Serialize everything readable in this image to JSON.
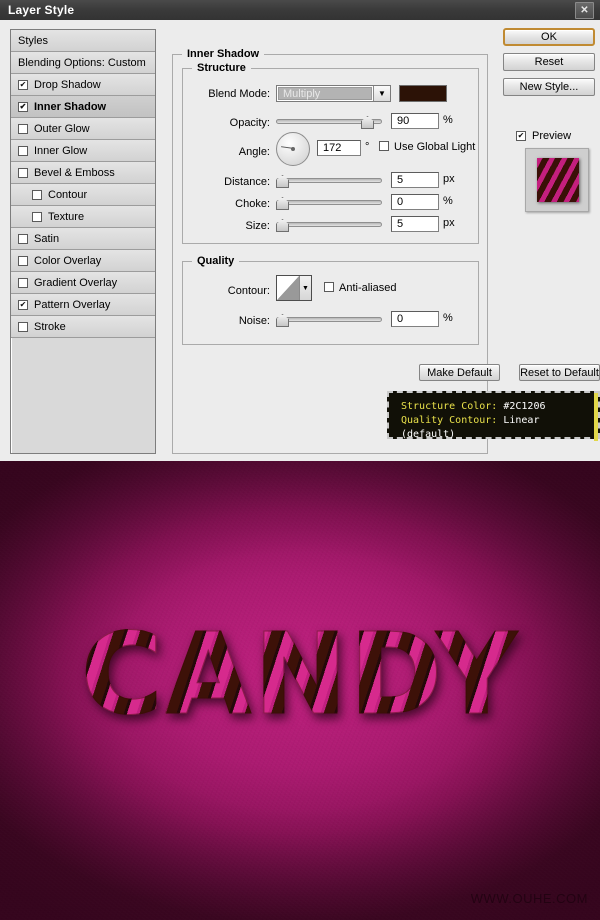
{
  "window": {
    "title": "Layer Style",
    "close_label": "✕"
  },
  "styles_panel": {
    "header": "Styles",
    "blending_options": "Blending Options: Custom",
    "effects": [
      {
        "label": "Drop Shadow",
        "checked": true,
        "indent": false,
        "selected": false
      },
      {
        "label": "Inner Shadow",
        "checked": true,
        "indent": false,
        "selected": true
      },
      {
        "label": "Outer Glow",
        "checked": false,
        "indent": false,
        "selected": false
      },
      {
        "label": "Inner Glow",
        "checked": false,
        "indent": false,
        "selected": false
      },
      {
        "label": "Bevel & Emboss",
        "checked": false,
        "indent": false,
        "selected": false
      },
      {
        "label": "Contour",
        "checked": false,
        "indent": true,
        "selected": false
      },
      {
        "label": "Texture",
        "checked": false,
        "indent": true,
        "selected": false
      },
      {
        "label": "Satin",
        "checked": false,
        "indent": false,
        "selected": false
      },
      {
        "label": "Color Overlay",
        "checked": false,
        "indent": false,
        "selected": false
      },
      {
        "label": "Gradient Overlay",
        "checked": false,
        "indent": false,
        "selected": false
      },
      {
        "label": "Pattern Overlay",
        "checked": true,
        "indent": false,
        "selected": false
      },
      {
        "label": "Stroke",
        "checked": false,
        "indent": false,
        "selected": false
      }
    ]
  },
  "buttons": {
    "ok": "OK",
    "reset": "Reset",
    "new_style": "New Style...",
    "make_default": "Make Default",
    "reset_to_default": "Reset to Default"
  },
  "preview": {
    "label": "Preview",
    "checked": true
  },
  "inner_shadow": {
    "group_title": "Inner Shadow",
    "structure": {
      "group_title": "Structure",
      "blend_mode_label": "Blend Mode:",
      "blend_mode_value": "Multiply",
      "color_hex": "#2C1206",
      "opacity_label": "Opacity:",
      "opacity_value": "90",
      "opacity_unit": "%",
      "angle_label": "Angle:",
      "angle_value": "172",
      "angle_unit": "°",
      "use_global_light_label": "Use Global Light",
      "use_global_light_checked": false,
      "distance_label": "Distance:",
      "distance_value": "5",
      "distance_unit": "px",
      "choke_label": "Choke:",
      "choke_value": "0",
      "choke_unit": "%",
      "size_label": "Size:",
      "size_value": "5",
      "size_unit": "px"
    },
    "quality": {
      "group_title": "Quality",
      "contour_label": "Contour:",
      "contour_value": "Linear (default)",
      "anti_aliased_label": "Anti-aliased",
      "anti_aliased_checked": false,
      "noise_label": "Noise:",
      "noise_value": "0",
      "noise_unit": "%"
    }
  },
  "tooltip": {
    "line1_key": "Structure Color:",
    "line1_val": " #2C1206",
    "line2_key": "Quality Contour:",
    "line2_val": " Linear (default)"
  },
  "artwork": {
    "text": "CANDY",
    "watermark": "WWW.OUHE.COM"
  },
  "colors": {
    "shadow_color": "#2C1206",
    "accent_ok_border": "#C08A32",
    "tooltip_key": "#E8E04A",
    "background_magenta": "#B01A73"
  }
}
